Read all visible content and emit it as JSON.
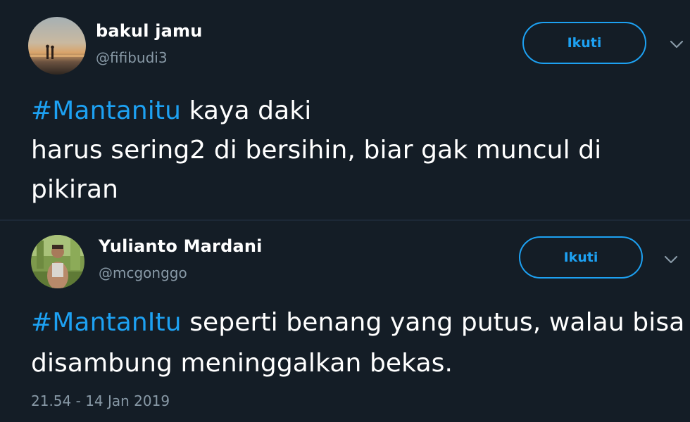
{
  "tweets": [
    {
      "display_name": "bakul jamu",
      "handle": "@fifibudi3",
      "follow_label": "Ikuti",
      "hashtag": "#Mantanitu",
      "text_after_hashtag": " kaya daki",
      "text_line2": "harus sering2 di bersihin, biar gak muncul di pikiran",
      "avatar_icon": "sunset-beach-avatar"
    },
    {
      "display_name": "Yulianto Mardani",
      "handle": "@mcgonggo",
      "follow_label": "Ikuti",
      "hashtag": "#MantanItu",
      "text_after_hashtag": " seperti benang yang putus, walau bisa disambung meninggalkan bekas.",
      "timestamp": "21.54 - 14 Jan 2019",
      "avatar_icon": "man-outdoors-avatar"
    }
  ],
  "icons": {
    "menu": "chevron-down-icon"
  },
  "colors": {
    "background": "#141d26",
    "accent": "#1da1f2",
    "secondary_text": "#8899a6",
    "primary_text": "#ffffff"
  }
}
